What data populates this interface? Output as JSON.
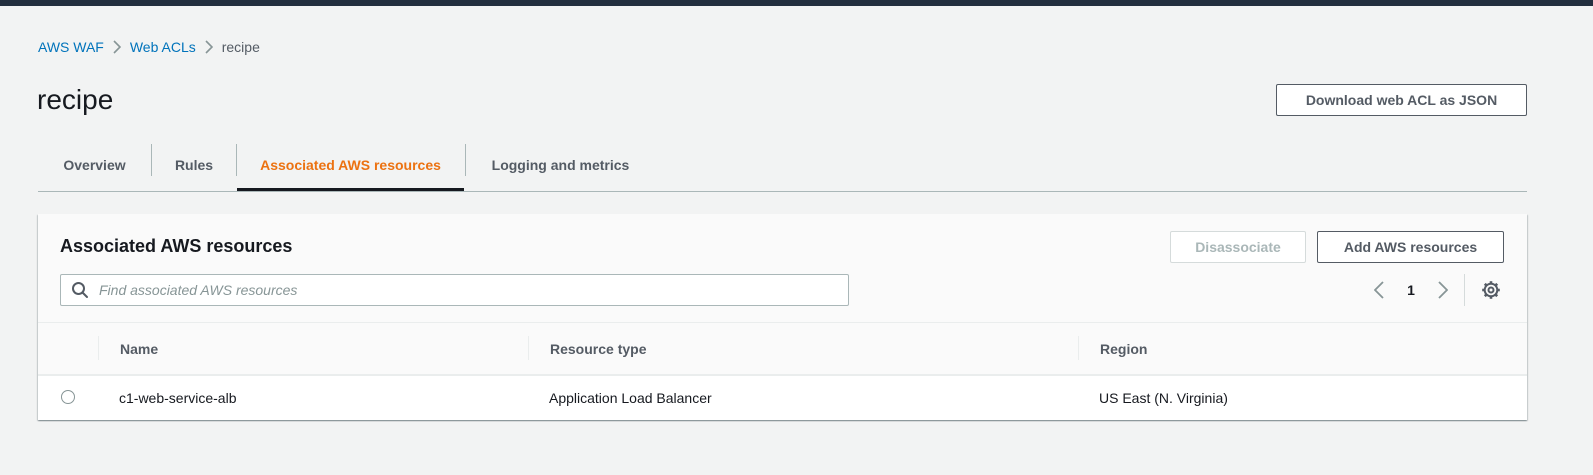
{
  "breadcrumb": {
    "items": [
      {
        "label": "AWS WAF"
      },
      {
        "label": "Web ACLs"
      }
    ],
    "current": "recipe"
  },
  "page": {
    "title": "recipe",
    "download_label": "Download web ACL as JSON"
  },
  "tabs": [
    {
      "label": "Overview",
      "active": false
    },
    {
      "label": "Rules",
      "active": false
    },
    {
      "label": "Associated AWS resources",
      "active": true
    },
    {
      "label": "Logging and metrics",
      "active": false
    }
  ],
  "panel": {
    "title": "Associated AWS resources",
    "disassociate_label": "Disassociate",
    "add_label": "Add AWS resources",
    "search_placeholder": "Find associated AWS resources",
    "search_value": "",
    "current_page": "1",
    "columns": [
      "Name",
      "Resource type",
      "Region"
    ],
    "rows": [
      {
        "name": "c1-web-service-alb",
        "type": "Application Load Balancer",
        "region": "US East (N. Virginia)",
        "selected": false
      }
    ]
  },
  "colors": {
    "link": "#0073bb",
    "active_tab": "#ec7211",
    "header_bar": "#232f3e",
    "text": "#16191f",
    "muted": "#545b64"
  }
}
